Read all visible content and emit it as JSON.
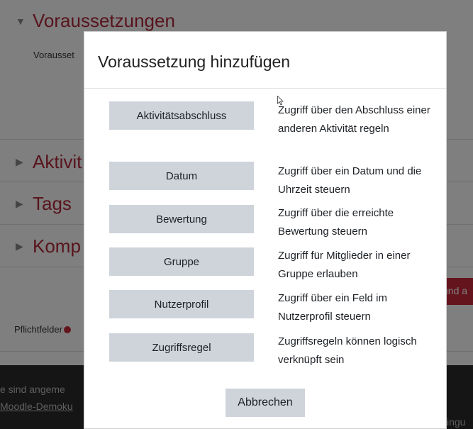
{
  "background": {
    "sections": [
      {
        "title": "Voraussetzungen"
      },
      {
        "title": "Aktivit"
      },
      {
        "title": "Tags"
      },
      {
        "title": "Komp"
      }
    ],
    "voraussetzungen_text": "Vorausset",
    "red_button_label": "und a",
    "required_label": "Pflichtfelder",
    "footer": {
      "line1": "e sind angeme",
      "line2": "Moodle-Demoku",
      "right_text": "ingu"
    }
  },
  "modal": {
    "title": "Voraussetzung hinzufügen",
    "options": [
      {
        "label": "Aktivitätsabschluss",
        "description": "Zugriff über den Abschluss einer anderen Aktivität regeln"
      },
      {
        "label": "Datum",
        "description": "Zugriff über ein Datum und die Uhrzeit steuern"
      },
      {
        "label": "Bewertung",
        "description": "Zugriff über die erreichte Bewertung steuern"
      },
      {
        "label": "Gruppe",
        "description": "Zugriff für Mitglieder in einer Gruppe erlauben"
      },
      {
        "label": "Nutzerprofil",
        "description": "Zugriff über ein Feld im Nutzerprofil steuern"
      },
      {
        "label": "Zugriffsregel",
        "description": "Zugriffsregeln können logisch verknüpft sein"
      }
    ],
    "cancel_label": "Abbrechen"
  },
  "colors": {
    "accent": "#b0293a",
    "button_bg": "#ced4da",
    "overlay": "rgba(0,0,0,0.5)"
  }
}
